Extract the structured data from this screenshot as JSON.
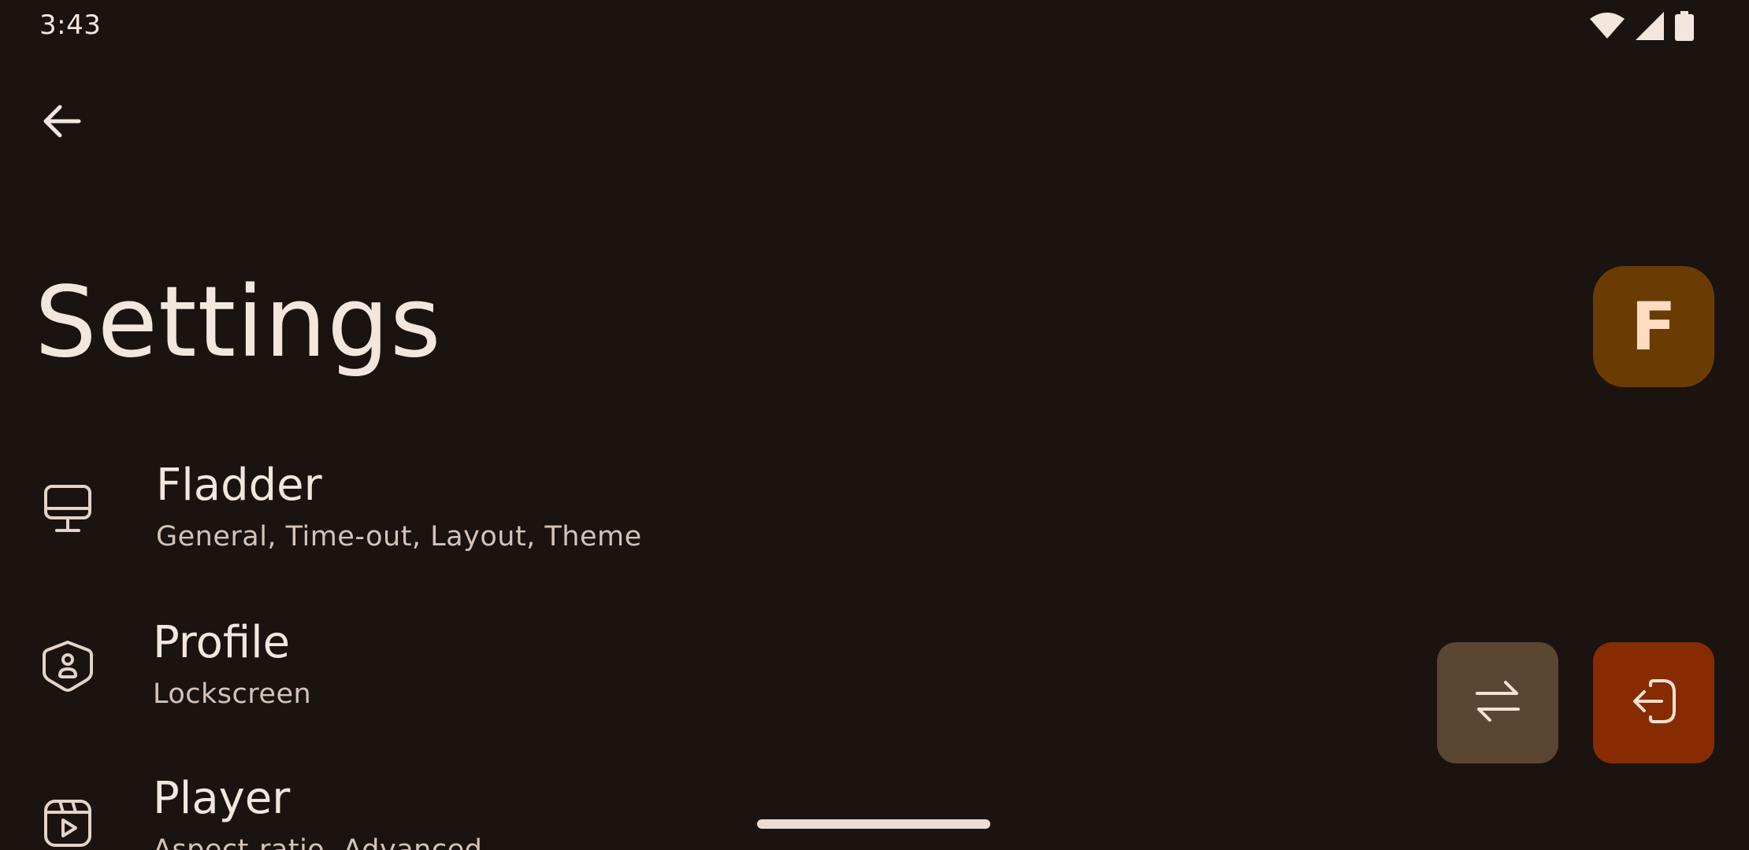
{
  "status_bar": {
    "time": "3:43",
    "icons": [
      "wifi-icon",
      "signal-icon",
      "battery-icon"
    ]
  },
  "top_bar": {
    "back_icon": "arrow-back-icon"
  },
  "header": {
    "title": "Settings",
    "avatar_letter": "F"
  },
  "settings_items": [
    {
      "icon": "monitor-icon",
      "label": "Fladder",
      "subtitle": "General, Time-out, Layout, Theme"
    },
    {
      "icon": "shield-person-icon",
      "label": "Profile",
      "subtitle": "Lockscreen"
    },
    {
      "icon": "video-player-icon",
      "label": "Player",
      "subtitle": "Aspect-ratio, Advanced"
    }
  ],
  "actions": {
    "switch_icon": "swap-arrows-icon",
    "logout_icon": "logout-icon"
  },
  "colors": {
    "background": "#1a1310",
    "avatar": "#6a3c04",
    "switch_button": "#5a4633",
    "logout_button": "#872b03",
    "text": "#f3e6dd"
  }
}
